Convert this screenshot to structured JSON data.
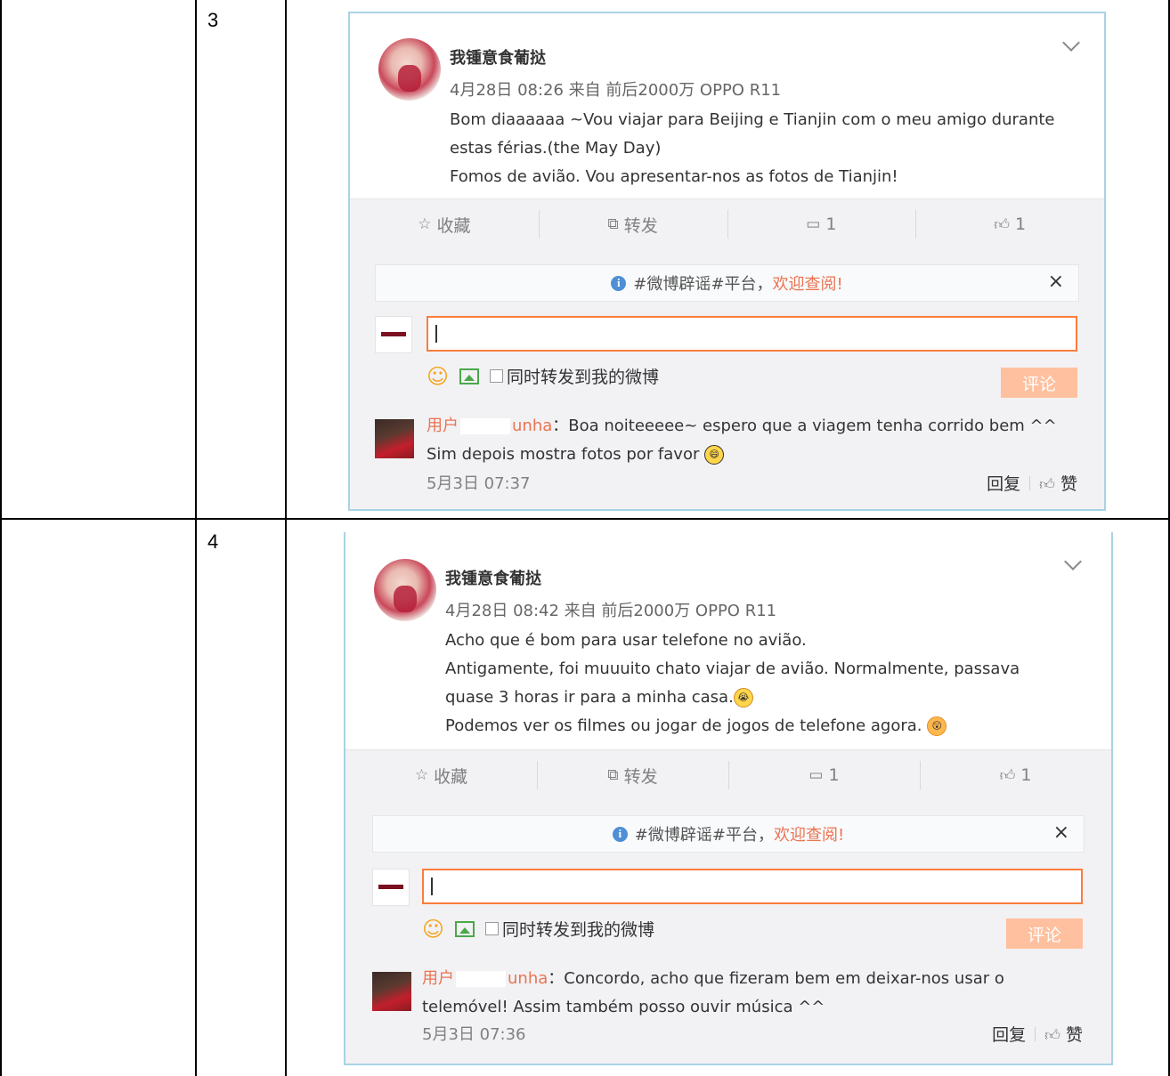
{
  "rows": [
    {
      "number": "3",
      "post": {
        "author": "我锺意食葡挞",
        "meta": "4月28日 08:26 来自 前后2000万 OPPO R11",
        "lines": [
          "Bom diaaaaaa ~Vou viajar para Beijing e Tianjin com o meu amigo durante",
          "estas férias.(the May Day)",
          "Fomos de avião. Vou apresentar-nos as fotos de Tianjin!"
        ],
        "actions": {
          "favorite": "收藏",
          "repost": "转发",
          "comment_count": "1",
          "like_count": "1"
        },
        "notice": {
          "prefix": "#微博辟谣#平台，",
          "highlight": "欢迎查阅!",
          "close": "×"
        },
        "repost_checkbox": "同时转发到我的微博",
        "submit": "评论",
        "comment": {
          "user_prefix": "用户",
          "user_suffix": "unha",
          "colon": "：",
          "text1": "Boa noiteeeee~ espero que a viagem tenha corrido bem ^^",
          "text2": "Sim depois mostra fotos por favor",
          "time": "5月3日 07:37",
          "reply": "回复",
          "like": "赞"
        }
      }
    },
    {
      "number": "4",
      "post": {
        "author": "我锺意食葡挞",
        "meta": "4月28日 08:42 来自 前后2000万 OPPO R11",
        "lines": [
          "Acho que é bom para usar telefone no avião.",
          "Antigamente, foi muuuito chato viajar de avião. Normalmente, passava",
          "quase 3 horas ir para a minha casa.",
          "Podemos ver os filmes ou jogar de jogos de telefone agora."
        ],
        "actions": {
          "favorite": "收藏",
          "repost": "转发",
          "comment_count": "1",
          "like_count": "1"
        },
        "notice": {
          "prefix": "#微博辟谣#平台，",
          "highlight": "欢迎查阅!",
          "close": "×"
        },
        "repost_checkbox": "同时转发到我的微博",
        "submit": "评论",
        "comment": {
          "user_prefix": "用户",
          "user_suffix": "unha",
          "colon": "：",
          "text1": "Concordo, acho que fizeram bem em deixar-nos usar o",
          "text2": "telemóvel! Assim também posso ouvir música ^^",
          "time": "5月3日 07:36",
          "reply": "回复",
          "like": "赞"
        }
      }
    }
  ],
  "icons": {
    "favorite": "star-outline-icon",
    "repost": "share-icon",
    "comment": "comment-icon",
    "like": "thumbs-up-icon",
    "info": "info-icon",
    "emoji": "smiley-icon",
    "picture": "picture-icon",
    "chevron": "chevron-down-icon"
  },
  "colors": {
    "accent": "#eb7350",
    "input_border": "#fa7d3c",
    "submit_disabled": "#ffc09f",
    "card_border": "#a9d3e3"
  }
}
